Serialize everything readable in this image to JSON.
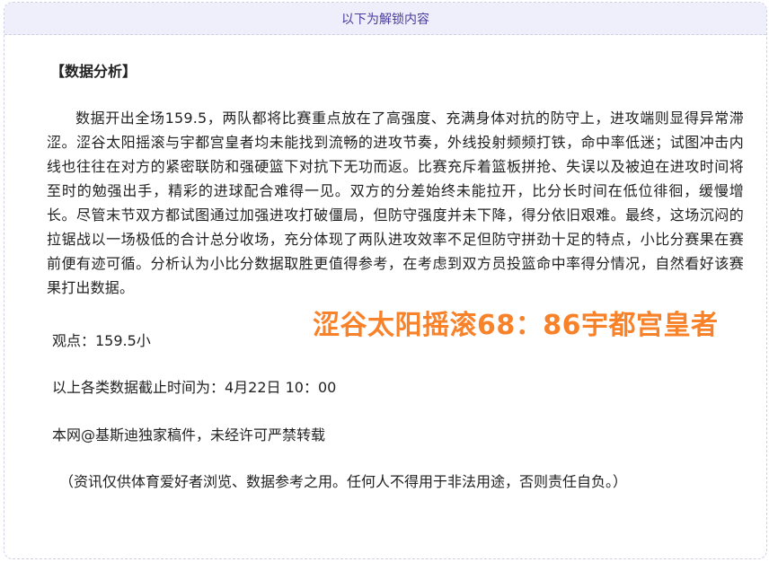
{
  "unlock_bar": {
    "label": "以下为解锁内容"
  },
  "article": {
    "heading": "【数据分析】",
    "paragraph": "数据开出全场159.5，两队都将比赛重点放在了高强度、充满身体对抗的防守上，进攻端则显得异常滞涩。涩谷太阳摇滚与宇都宫皇者均未能找到流畅的进攻节奏，外线投射频频打铁，命中率低迷；试图冲击内线也往往在对方的紧密联防和强硬篮下对抗下无功而返。比赛充斥着篮板拼抢、失误以及被迫在进攻时间将至时的勉强出手，精彩的进球配合难得一见。双方的分差始终未能拉开，比分长时间在低位徘徊，缓慢增长。尽管末节双方都试图通过加强进攻打破僵局，但防守强度并未下降，得分依旧艰难。最终，这场沉闷的拉锯战以一场极低的合计总分收场，充分体现了两队进攻效率不足但防守拼劲十足的特点，小比分赛果在赛前便有迹可循。分析认为小比分数据取胜更值得参考，在考虑到双方员投篮命中率得分情况，自然看好该赛果打出数据。",
    "viewpoint": "观点：159.5小",
    "cutoff": "以上各类数据截止时间为：4月22日 10：00",
    "copyright": "本网@基斯迪独家稿件，未经许可严禁转载",
    "disclaimer": "（资讯仅供体育爱好者浏览、数据参考之用。任何人不得用于非法用途，否则责任自负。）"
  },
  "score_overlay": {
    "text": "涩谷太阳摇滚68：86宇都宫皇者",
    "color": "#f7822a"
  },
  "colors": {
    "unlock_bg": "#efeefb",
    "unlock_text": "#4b3b9c",
    "border": "#cfcfe6"
  }
}
